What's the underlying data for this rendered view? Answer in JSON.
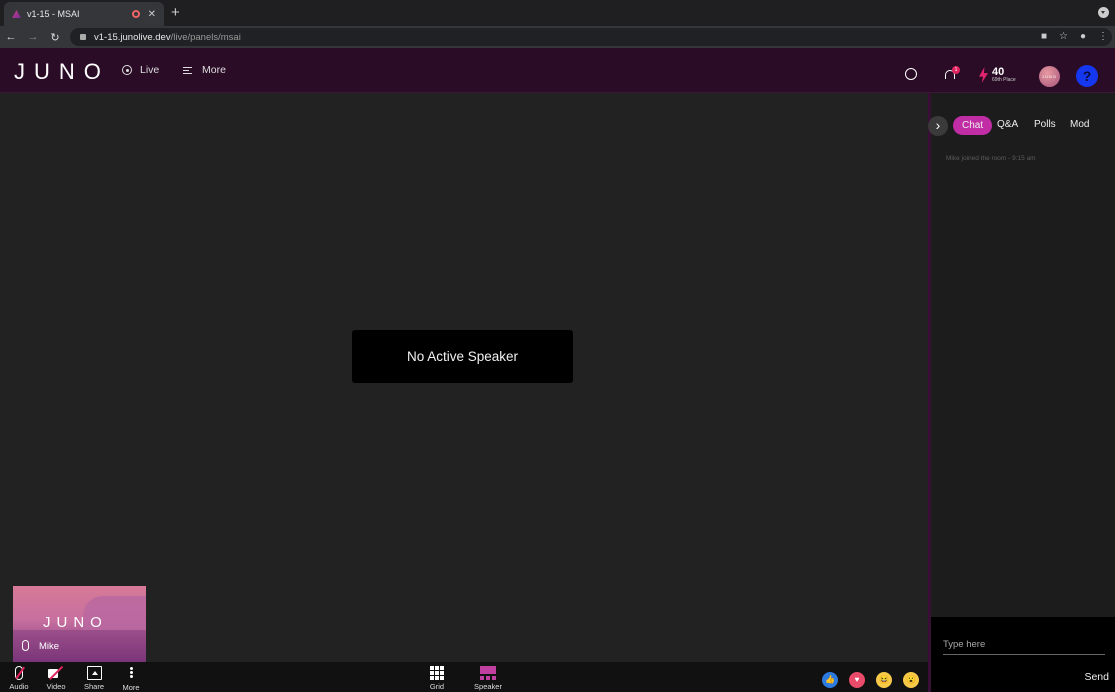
{
  "browser": {
    "tab_title": "v1-15 - MSAI",
    "new_tab": "+",
    "url_host": "v1-15.junolive.dev",
    "url_path": "/live/panels/msai"
  },
  "header": {
    "logo": "JUNO",
    "nav_live": "Live",
    "nav_more": "More",
    "notification_count": "1",
    "points": "40",
    "place": "69th Place",
    "avatar_text": "JUNO",
    "help": "?"
  },
  "stage": {
    "no_speaker": "No Active Speaker",
    "self_tile": {
      "logo": "JUNO",
      "name": "Mike"
    }
  },
  "toolbar": {
    "audio": "Audio",
    "video": "Video",
    "share": "Share",
    "more": "More",
    "grid": "Grid",
    "speaker": "Speaker"
  },
  "reactions": [
    "like",
    "love",
    "haha",
    "wow"
  ],
  "side_panel": {
    "tabs": [
      "Chat",
      "Q&A",
      "Polls",
      "Mod"
    ],
    "active_tab": "Chat",
    "system_message": "Mike joined the room - 9:15 am",
    "input_placeholder": "Type here",
    "send_label": "Send"
  },
  "colors": {
    "header_bg": "#2a0c26",
    "accent": "#c12da4",
    "help_blue": "#1537f0",
    "alert_red": "#e0245e"
  }
}
